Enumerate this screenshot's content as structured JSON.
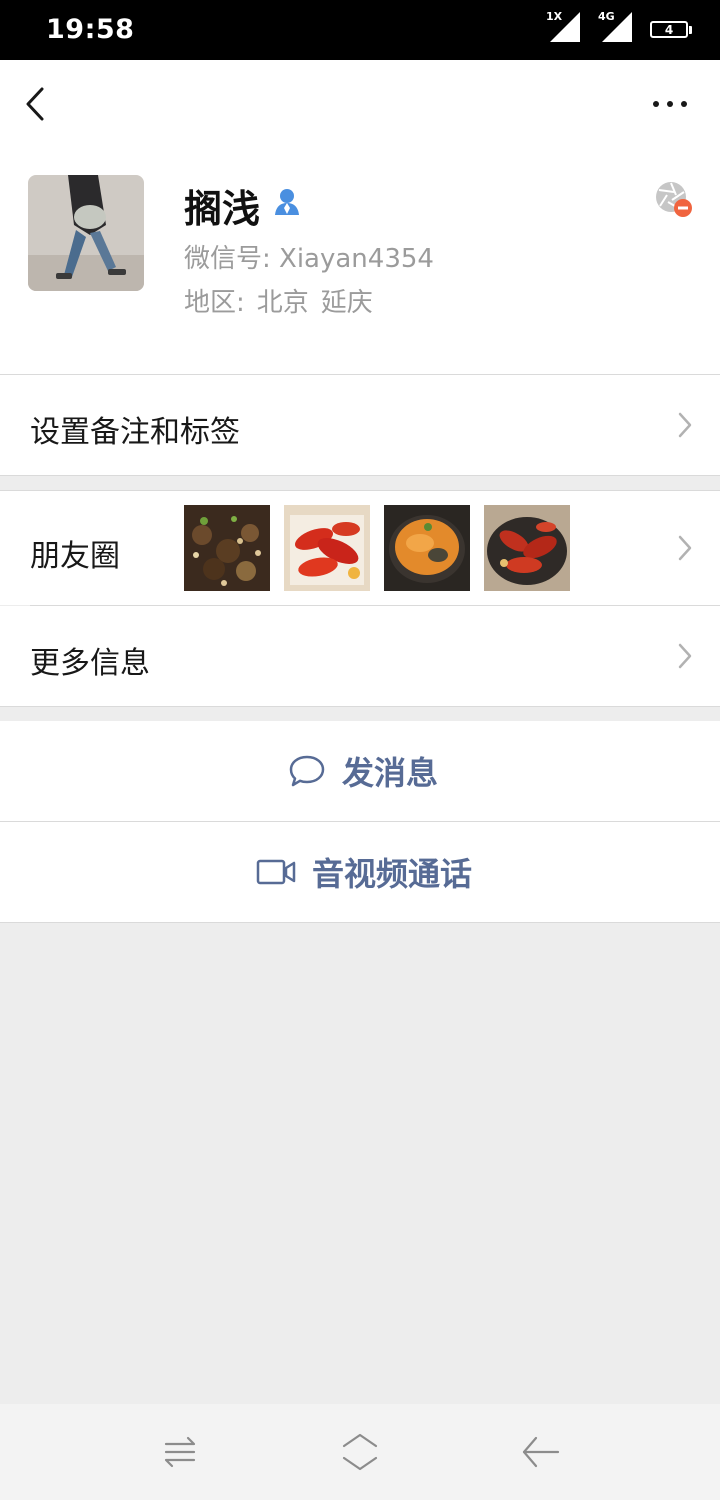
{
  "status_bar": {
    "time": "19:58",
    "sim1_label": "1X",
    "sim2_label": "4G",
    "battery": "4"
  },
  "header": {
    "back_icon": "chevron-left-icon",
    "more_icon": "more-horizontal-icon"
  },
  "profile": {
    "name": "搁浅",
    "wechat_id": "微信号: Xiayan4354",
    "region_label": "地区:",
    "region_city": "北京",
    "region_district": "延庆"
  },
  "rows": {
    "remark_tags": "设置备注和标签",
    "moments": "朋友圈",
    "more_info": "更多信息"
  },
  "actions": {
    "send_message": "发消息",
    "video_call": "音视频通话"
  },
  "colors": {
    "accent": "#576b95",
    "secondary_text": "#9b9b9b",
    "background": "#ededed"
  }
}
